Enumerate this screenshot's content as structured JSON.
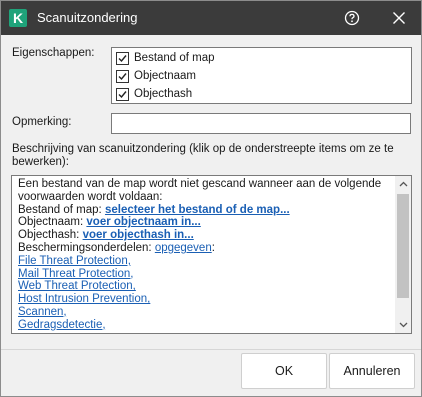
{
  "window": {
    "title": "Scanuitzondering",
    "logo_letter": "K"
  },
  "properties": {
    "label": "Eigenschappen:",
    "items": [
      {
        "label": "Bestand of map",
        "checked": true
      },
      {
        "label": "Objectnaam",
        "checked": true
      },
      {
        "label": "Objecthash",
        "checked": true
      }
    ]
  },
  "remark": {
    "label": "Opmerking:",
    "value": ""
  },
  "description": {
    "label": "Beschrijving van scanuitzondering (klik op de onderstreepte items om ze te bewerken):",
    "intro_line1": "Een bestand van de map wordt niet gescand wanneer aan de volgende",
    "intro_line2": "voorwaarden wordt voldaan:",
    "file_label": "Bestand of map: ",
    "file_link": "selecteer het bestand of de map...",
    "name_label": "Objectnaam: ",
    "name_link": "voer objectnaam in...",
    "hash_label": "Objecthash: ",
    "hash_link": "voer objecthash in...",
    "components_label": "Beschermingsonderdelen: ",
    "components_link": "opgegeven",
    "components_suffix": ":",
    "components": [
      "File Threat Protection,",
      "Mail Threat Protection,",
      "Web Threat Protection,",
      "Host Intrusion Prevention,",
      "Scannen,",
      "Gedragsdetectie,"
    ]
  },
  "buttons": {
    "ok": "OK",
    "cancel": "Annuleren"
  },
  "colors": {
    "titlebar": "#3b3b3b",
    "logo": "#1fa37a",
    "link": "#1a5fb4"
  }
}
